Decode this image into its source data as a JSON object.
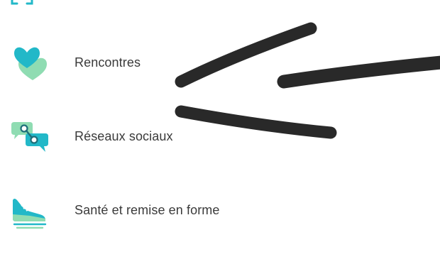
{
  "categories": [
    {
      "label": "Rencontres",
      "icon": "hearts-icon"
    },
    {
      "label": "Réseaux sociaux",
      "icon": "chat-bubbles-icon"
    },
    {
      "label": "Santé et remise en forme",
      "icon": "sneaker-icon"
    }
  ],
  "colors": {
    "teal": "#22b8c8",
    "mint": "#8fdcb2",
    "text": "#3a3a3a",
    "annotation": "#1e1e1e"
  }
}
